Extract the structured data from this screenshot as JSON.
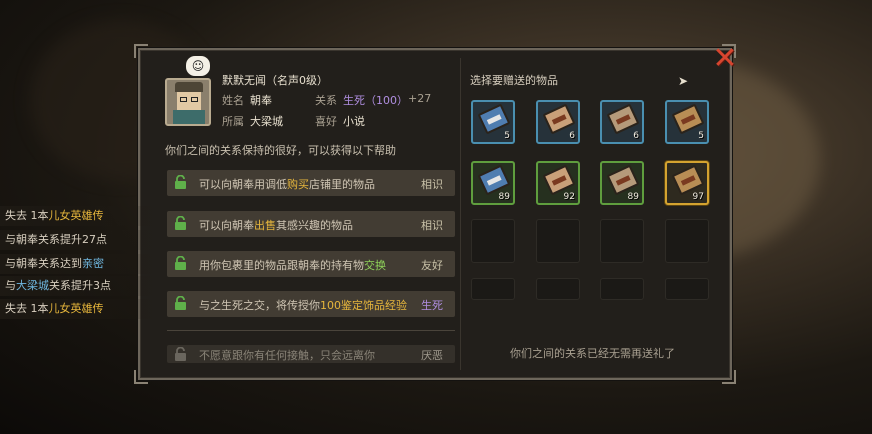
{
  "npc": {
    "name": "默默无闻（名声0级）",
    "name_label": "姓名",
    "name_value": "朝奉",
    "relation_label": "关系",
    "relation_value": "生死（100）",
    "relation_delta": "+27",
    "home_label": "所属",
    "home_value": "大梁城",
    "hobby_label": "喜好",
    "hobby_value": "小说",
    "speech_icon": "smile-face-icon"
  },
  "relation_note": "你们之间的关系保持的很好，可以获得以下帮助",
  "benefits": [
    {
      "pre": "可以向朝奉用调低",
      "hl": "购买",
      "post": "店铺里的物品",
      "tag": "相识",
      "tag_color": "#c9c2a8",
      "hl_color": "#e6b63c"
    },
    {
      "pre": "可以向朝奉",
      "hl": "出售",
      "post": "其感兴趣的物品",
      "tag": "相识",
      "tag_color": "#c9c2a8",
      "hl_color": "#e6b63c"
    },
    {
      "pre": "用你包裹里的物品跟朝奉的持有物",
      "hl": "交换",
      "post": "",
      "tag": "友好",
      "tag_color": "#c9c2a8",
      "hl_color": "#8fd35a"
    },
    {
      "pre": "与之生死之交，将传授你",
      "hl": "100鉴定饰品经验",
      "post": "",
      "tag": "生死",
      "tag_color": "#b08ee0",
      "hl_color": "#e6b63c"
    },
    {
      "pre": "不愿意跟你有任何接触，只会远离你",
      "hl": "",
      "post": "",
      "tag": "厌恶",
      "tag_color": "#a09a8e",
      "hl_color": "#a09a8e"
    }
  ],
  "gift": {
    "title": "选择要赠送的物品",
    "footer": "你们之间的关系已经无需再送礼了",
    "items": [
      {
        "frame": "blue",
        "cover": "#4f7db0",
        "count": "5"
      },
      {
        "frame": "blue",
        "cover": "#c9a079",
        "count": "6"
      },
      {
        "frame": "blue",
        "cover": "#b59a7a",
        "count": "6"
      },
      {
        "frame": "blue",
        "cover": "#b88d55",
        "count": "5"
      },
      {
        "frame": "green",
        "cover": "#4f7db0",
        "count": "89"
      },
      {
        "frame": "green",
        "cover": "#c9a079",
        "count": "92"
      },
      {
        "frame": "green",
        "cover": "#b59a7a",
        "count": "89"
      },
      {
        "frame": "gold",
        "cover": "#b88d55",
        "count": "97"
      }
    ]
  },
  "log": [
    {
      "pre": "失去 1本",
      "hl": "儿女英雄传",
      "post": "",
      "hl_color": "#e6b63c"
    },
    {
      "pre": "与朝奉关系提升27点",
      "hl": "",
      "post": "",
      "hl_color": "#e6b63c"
    },
    {
      "pre": "与朝奉关系达到",
      "hl": "亲密",
      "post": "",
      "hl_color": "#6fb7e0"
    },
    {
      "pre": "与",
      "hl": "大梁城",
      "post": "关系提升3点",
      "hl_color": "#6fb7e0"
    },
    {
      "pre": "失去 1本",
      "hl": "儿女英雄传",
      "post": "",
      "hl_color": "#e6b63c"
    }
  ],
  "close_icon": "close-x-icon",
  "colors": {
    "accent_gold": "#e6b63c",
    "relation_purple": "#b08ee0",
    "panel_bg": "#221f1b"
  }
}
